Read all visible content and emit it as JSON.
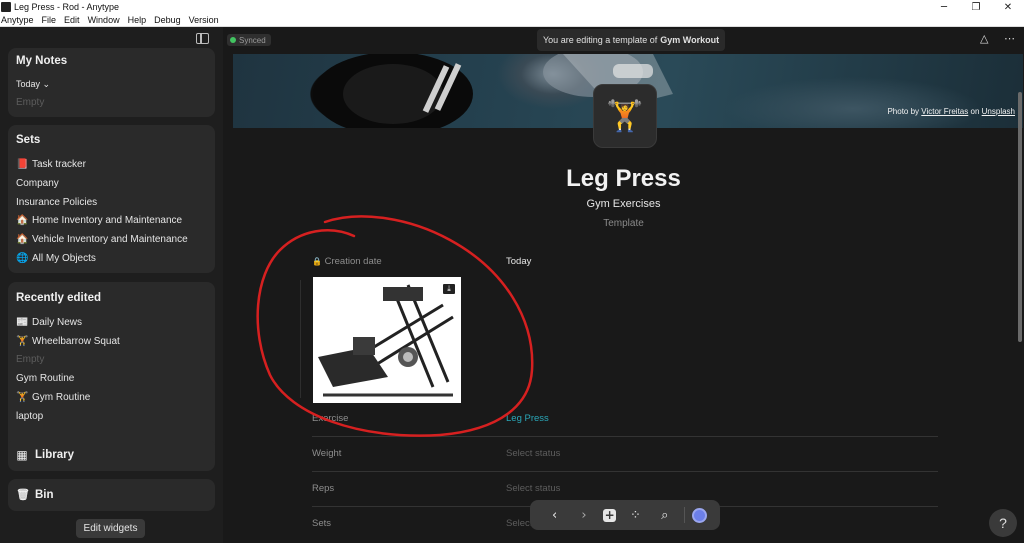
{
  "window": {
    "title": "Leg Press - Rod - Anytype",
    "controls": [
      "─",
      "❐",
      "✕"
    ]
  },
  "menu": [
    "Anytype",
    "File",
    "Edit",
    "Window",
    "Help",
    "Debug",
    "Version"
  ],
  "sidebar": {
    "my_notes": {
      "title": "My Notes",
      "filter": "Today ⌄",
      "empty": "Empty"
    },
    "sets": {
      "title": "Sets",
      "items": [
        {
          "icon": "📕",
          "label": "Task tracker"
        },
        {
          "icon": "",
          "label": "Company"
        },
        {
          "icon": "",
          "label": "Insurance Policies"
        },
        {
          "icon": "🏠",
          "label": "Home Inventory and Maintenance"
        },
        {
          "icon": "🏠",
          "label": "Vehicle Inventory and Maintenance"
        },
        {
          "icon": "🌐",
          "label": "All My Objects"
        }
      ]
    },
    "recent": {
      "title": "Recently edited",
      "items": [
        {
          "icon": "📰",
          "label": "Daily News",
          "muted": false
        },
        {
          "icon": "🏋",
          "label": "Wheelbarrow Squat",
          "muted": false
        },
        {
          "icon": "",
          "label": "Empty",
          "muted": true
        },
        {
          "icon": "",
          "label": "Gym Routine",
          "muted": false
        },
        {
          "icon": "🏋",
          "label": "Gym Routine",
          "muted": false
        },
        {
          "icon": "",
          "label": "laptop",
          "muted": false
        }
      ]
    },
    "library": {
      "icon": "▦",
      "label": "Library"
    },
    "bin": {
      "icon": "🗑",
      "label": "Bin"
    },
    "edit_widgets": "Edit widgets"
  },
  "header": {
    "sync_status": "Synced",
    "banner_prefix": "You are editing a template of",
    "banner_type": "Gym Workout",
    "icons": [
      "triangle-nodes-icon",
      "more-icon"
    ]
  },
  "cover": {
    "credit_prefix": "Photo by",
    "credit_author": "Victor Freitas",
    "credit_mid": "on",
    "credit_source": "Unsplash"
  },
  "page": {
    "icon": "🏋",
    "title": "Leg Press",
    "subtitle": "Gym Exercises",
    "type": "Template"
  },
  "properties": [
    {
      "label": "Creation date",
      "value": "Today",
      "style": "normal",
      "locked": true
    },
    {
      "label": "Exercise",
      "value": "Leg Press",
      "style": "link",
      "locked": false
    },
    {
      "label": "Weight",
      "value": "Select status",
      "style": "muted",
      "locked": false
    },
    {
      "label": "Reps",
      "value": "Select status",
      "style": "muted",
      "locked": false
    },
    {
      "label": "Sets",
      "value": "Select status",
      "style": "muted",
      "locked": false
    }
  ],
  "toolbar": {
    "back": "‹",
    "forward": "›",
    "add": "+",
    "graph": "⁘",
    "search": "⌕"
  },
  "help": "?",
  "colors": {
    "accent_link": "#2aa7b8",
    "synced_dot": "#42c461",
    "annotation": "#d62020",
    "background": "#191919",
    "widget": "#2a2a2a"
  }
}
